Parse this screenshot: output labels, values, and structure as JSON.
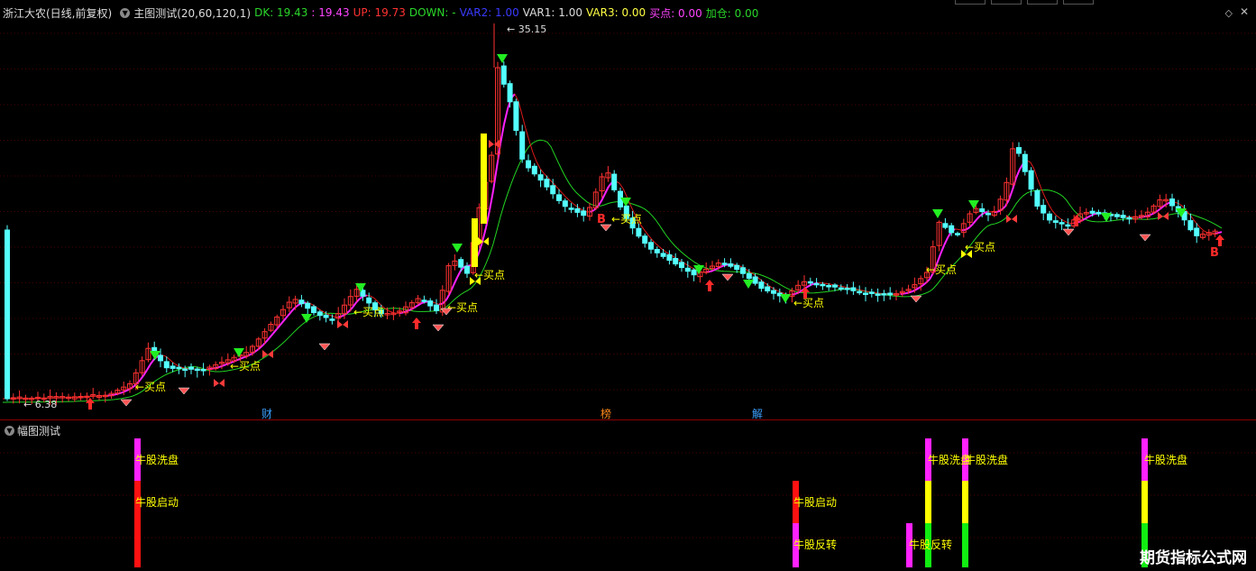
{
  "main": {
    "stock_title": "浙江大农(日线,前复权)",
    "indicator_name": "主图测试(20,60,120,1)",
    "dk": "DK: 19.43",
    "dk2": ": 19.43",
    "up": "UP: 19.73",
    "down": "DOWN: -",
    "var2": "VAR2: 1.00",
    "var1": "VAR1: 1.00",
    "var3": "VAR3: 0.00",
    "buy": "买点: 0.00",
    "add": "加仓: 0.00",
    "high_label": "35.15",
    "low_label": "6.38",
    "buy_label": "←买点",
    "markers": [
      {
        "t": "财",
        "color": "#3aa0ff"
      },
      {
        "t": "榜",
        "color": "#ff8a1a"
      },
      {
        "t": "解",
        "color": "#3aa0ff"
      }
    ]
  },
  "sub": {
    "title": "幅图测试",
    "wash": "牛股洗盘",
    "start": "牛股启动",
    "reverse": "牛股反转"
  },
  "watermark": "期货指标公式网",
  "colors": {
    "up_candle": "#ff3232",
    "down_candle": "#54ffff",
    "ma_green": "#22d422",
    "ma_red": "#e01a1a",
    "magenta": "#ff22ff",
    "yellow": "#ffff00",
    "grid": "#4a0000"
  }
}
